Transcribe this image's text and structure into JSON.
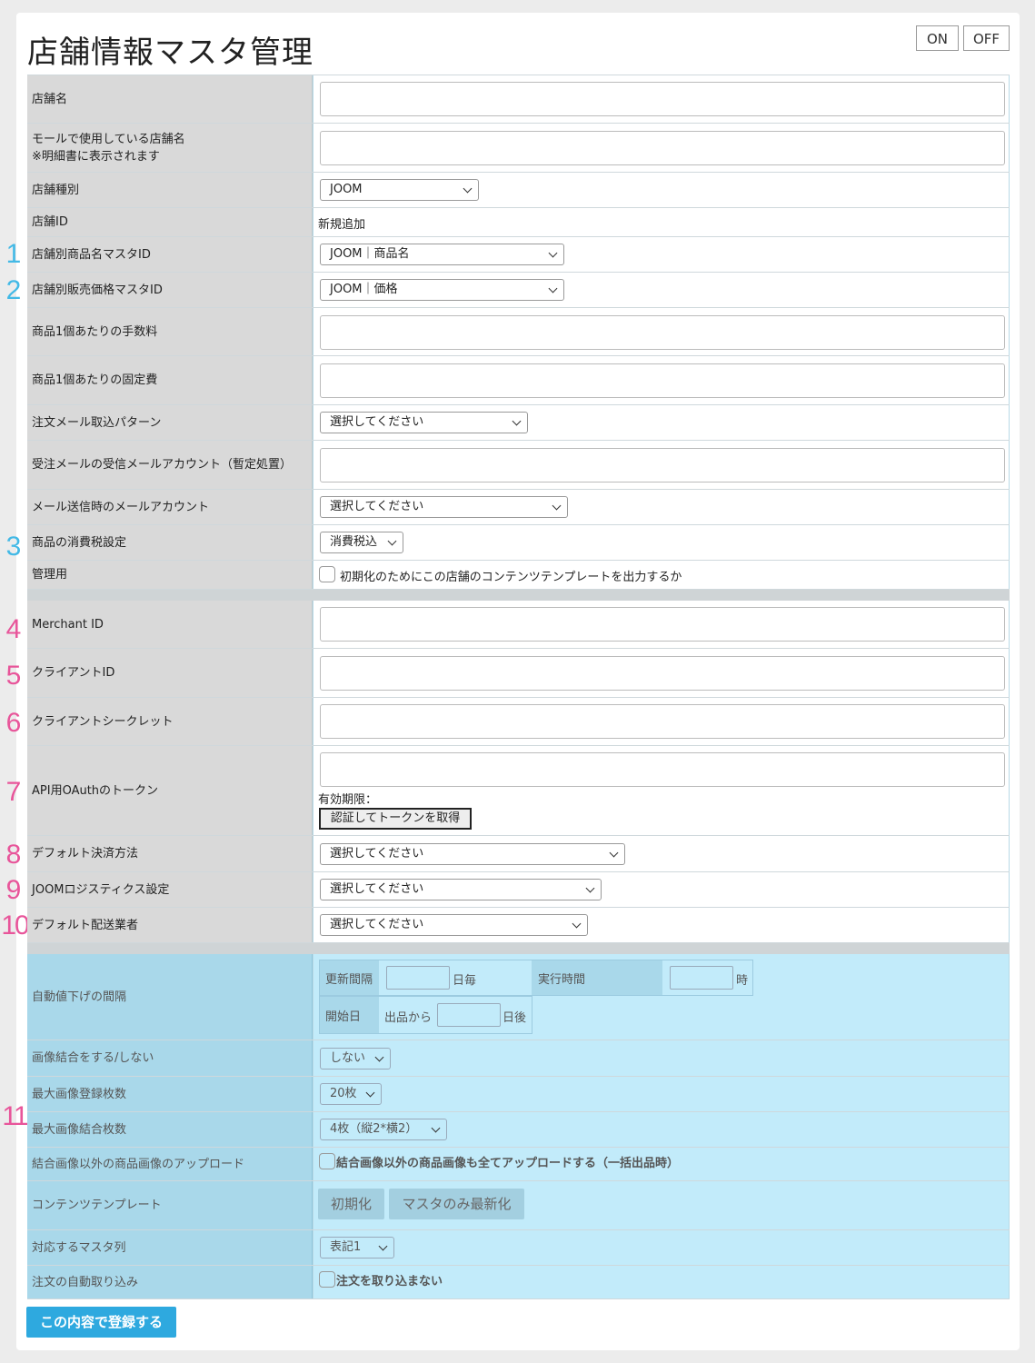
{
  "page": {
    "title": "店舗情報マスタ管理",
    "on_label": "ON",
    "off_label": "OFF"
  },
  "markers": [
    "1",
    "2",
    "3",
    "4",
    "5",
    "6",
    "7",
    "8",
    "9",
    "10",
    "11"
  ],
  "colors": {
    "marker_blue": "#43b9e6",
    "marker_pink": "#e8559a",
    "submit": "#2ea9df",
    "section_blue": "#c2ebfa"
  },
  "fields": {
    "store_name": {
      "label": "店舗名",
      "value": ""
    },
    "mall_store_name": {
      "label1": "モールで使用している店舗名",
      "label2": "※明細書に表示されます",
      "value": ""
    },
    "store_type": {
      "label": "店舗種別",
      "value": "JOOM"
    },
    "store_id": {
      "label": "店舗ID",
      "value": "新規追加"
    },
    "product_name_master": {
      "label": "店舗別商品名マスタID",
      "value": "JOOM｜商品名"
    },
    "price_master": {
      "label": "店舗別販売価格マスタID",
      "value": "JOOM｜価格"
    },
    "fee": {
      "label": "商品1個あたりの手数料",
      "value": ""
    },
    "fixed_cost": {
      "label": "商品1個あたりの固定費",
      "value": ""
    },
    "mail_pattern": {
      "label": "注文メール取込パターン",
      "value": "選択してください"
    },
    "receive_mail": {
      "label": "受注メールの受信メールアカウント（暫定処置）",
      "value": ""
    },
    "send_mail": {
      "label": "メール送信時のメールアカウント",
      "value": "選択してください"
    },
    "tax": {
      "label": "商品の消費税設定",
      "value": "消費税込"
    },
    "admin": {
      "label": "管理用",
      "checkbox_label": "初期化のためにこの店舗のコンテンツテンプレートを出力するか"
    },
    "merchant_id": {
      "label": "Merchant ID",
      "value": ""
    },
    "client_id": {
      "label": "クライアントID",
      "value": ""
    },
    "client_secret": {
      "label": "クライアントシークレット",
      "value": ""
    },
    "oauth": {
      "label": "API用OAuthのトークン",
      "value": "",
      "expiry": "有効期限：",
      "button": "認証してトークンを取得"
    },
    "payment": {
      "label": "デフォルト決済方法",
      "value": "選択してください"
    },
    "logistics": {
      "label": "JOOMロジスティクス設定",
      "value": "選択してください"
    },
    "carrier": {
      "label": "デフォルト配送業者",
      "value": "選択してください"
    }
  },
  "auto": {
    "label": "自動値下げの間隔",
    "update_interval": "更新間隔",
    "every_day": "日毎",
    "exec_time": "実行時間",
    "hour": "時",
    "start_day": "開始日",
    "from_listing": "出品から",
    "days_after": "日後",
    "image_merge": {
      "label": "画像結合をする/しない",
      "value": "しない"
    },
    "max_images": {
      "label": "最大画像登録枚数",
      "value": "20枚"
    },
    "max_merge": {
      "label": "最大画像結合枚数",
      "value": "4枚（縦2*横2）"
    },
    "upload_other": {
      "label": "結合画像以外の商品画像のアップロード",
      "checkbox_label": "結合画像以外の商品画像も全てアップロードする（一括出品時）"
    },
    "content_template": {
      "label": "コンテンツテンプレート",
      "btn_init": "初期化",
      "btn_refresh": "マスタのみ最新化"
    },
    "master_column": {
      "label": "対応するマスタ列",
      "value": "表記1"
    },
    "auto_import": {
      "label": "注文の自動取り込み",
      "checkbox_label": "注文を取り込まない"
    }
  },
  "submit": "この内容で登録する"
}
